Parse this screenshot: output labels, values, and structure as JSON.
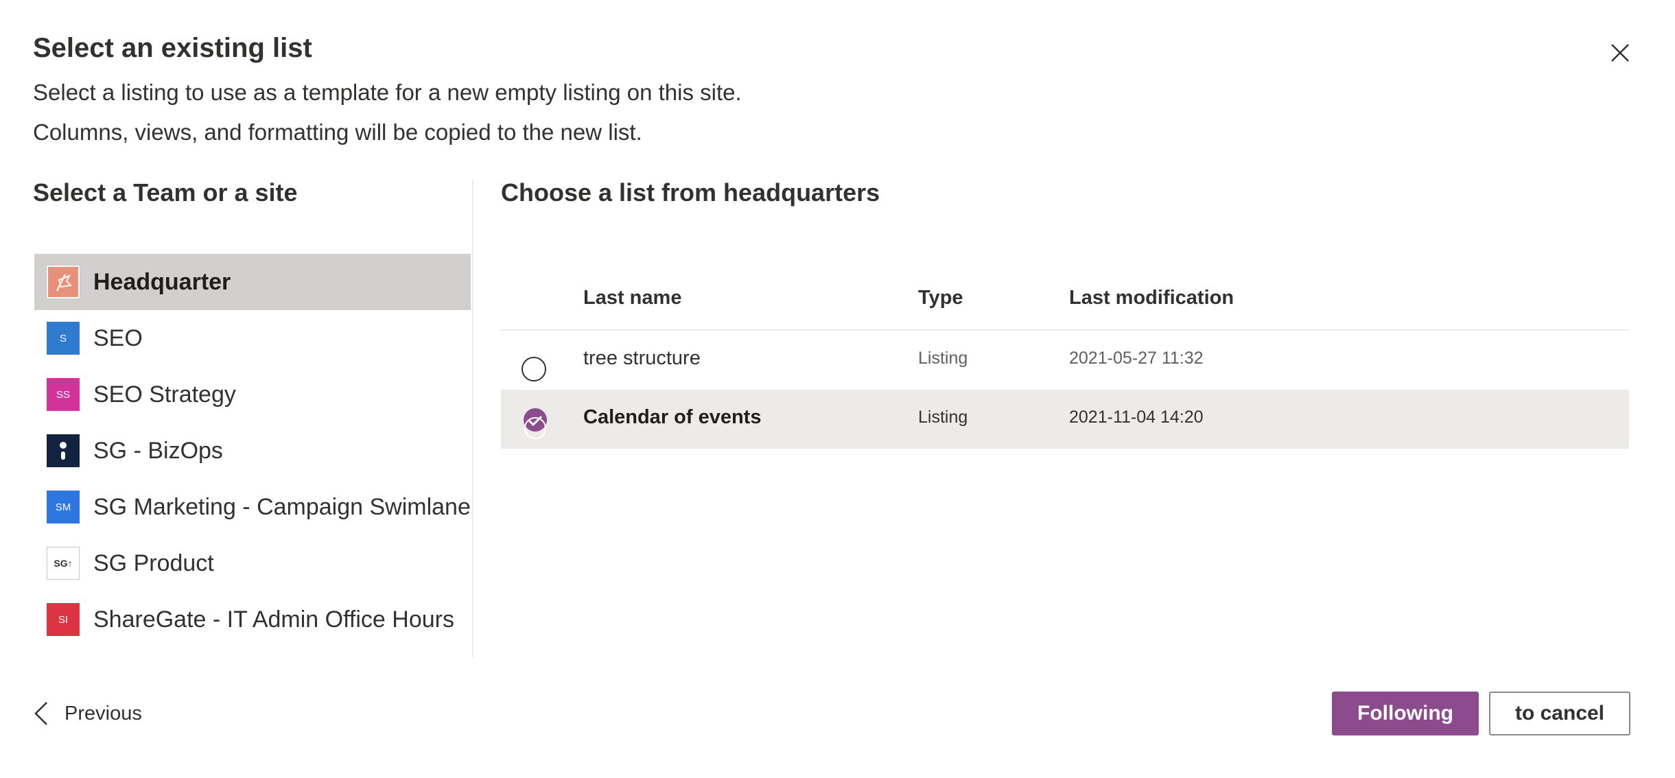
{
  "dialog": {
    "title": "Select an existing list",
    "description_line1": "Select a listing to use as a template for a new empty listing on this site.",
    "description_line2": "Columns, views, and formatting will be copied to the new list."
  },
  "sites": {
    "heading": "Select a Team or a site",
    "items": [
      {
        "label": "Headquarter",
        "icon_text": "",
        "icon_color": "#e8917a",
        "selected": true
      },
      {
        "label": "SEO",
        "icon_text": "S",
        "icon_color": "#2e7bcf",
        "selected": false
      },
      {
        "label": "SEO Strategy",
        "icon_text": "SS",
        "icon_color": "#d1339b",
        "selected": false
      },
      {
        "label": "SG - BizOps",
        "icon_text": "",
        "icon_color": "#13223f",
        "selected": false
      },
      {
        "label": "SG Marketing - Campaign Swimlane",
        "icon_text": "SM",
        "icon_color": "#2f77e0",
        "selected": false
      },
      {
        "label": "SG Product",
        "icon_text": "SG↑",
        "icon_color": "#ffffff",
        "selected": false
      },
      {
        "label": "ShareGate - IT Admin Office Hours",
        "icon_text": "SI",
        "icon_color": "#dd3444",
        "selected": false
      }
    ]
  },
  "lists": {
    "heading": "Choose a list from headquarters",
    "columns": {
      "name": "Last name",
      "type": "Type",
      "modified": "Last modification"
    },
    "rows": [
      {
        "name": "tree structure",
        "type": "Listing",
        "modified": "2021-05-27 11:32",
        "selected": false
      },
      {
        "name": "Calendar of events",
        "type": "Listing",
        "modified": "2021-11-04 14:20",
        "selected": true
      }
    ]
  },
  "footer": {
    "previous_label": "Previous",
    "next_label": "Following",
    "cancel_label": "to cancel"
  },
  "colors": {
    "accent": "#8c4b8c",
    "selected_site_bg": "#d2d0ce",
    "selected_row_bg": "#edebe9"
  }
}
